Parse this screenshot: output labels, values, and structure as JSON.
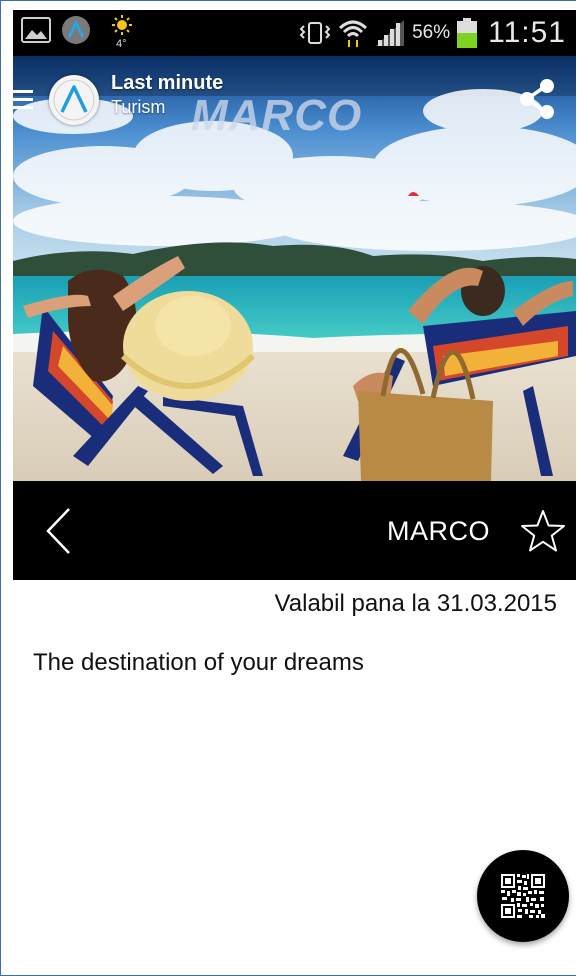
{
  "status_bar": {
    "battery_percent": "56%",
    "time": "11:51",
    "weather_temp": "4°",
    "icons": [
      "image-icon",
      "app-logo-icon",
      "weather-sun-icon",
      "vibrate-icon",
      "wifi-icon",
      "signal-icon",
      "battery-icon"
    ],
    "battery_color": "#7ed321",
    "wifi_activity_color": "#f5c518"
  },
  "header": {
    "app_title_line1": "Last minute",
    "app_title_line2": "Turism",
    "watermark_text": "MARCO",
    "icons": [
      "menu-icon",
      "app-logo-icon",
      "share-icon"
    ]
  },
  "action_bar": {
    "title": "MARCO",
    "icons": [
      "back-arrow-icon",
      "star-outline-icon"
    ]
  },
  "content": {
    "valid_until": "Valabil pana la 31.03.2015",
    "description": "The destination of your dreams"
  },
  "fab": {
    "icon": "qr-code-icon"
  }
}
